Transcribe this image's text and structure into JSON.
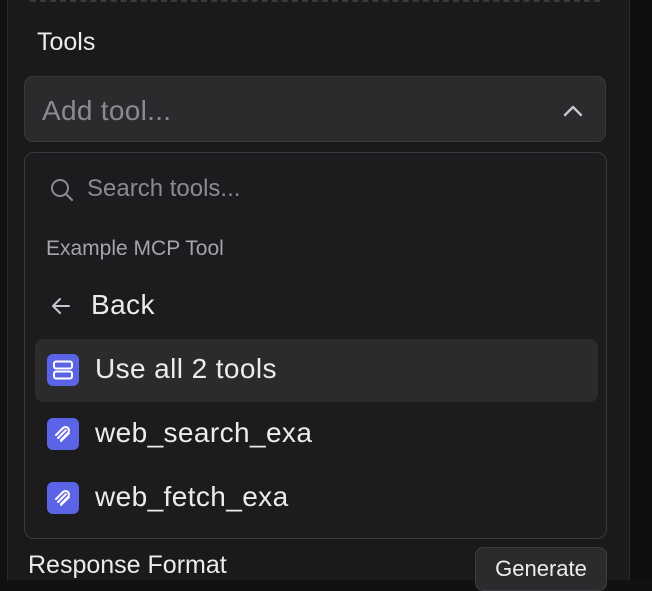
{
  "tools_section": {
    "label": "Tools",
    "select": {
      "placeholder": "Add tool...",
      "chevron_icon": "chevron-up-icon"
    }
  },
  "dropdown": {
    "search": {
      "placeholder": "Search tools...",
      "icon": "search-icon"
    },
    "group_label": "Example MCP Tool",
    "back": {
      "label": "Back",
      "icon": "arrow-left-icon"
    },
    "items": [
      {
        "label": "Use all 2 tools",
        "icon": "server-stack-icon",
        "highlighted": true
      },
      {
        "label": "web_search_exa",
        "icon": "tool-icon",
        "highlighted": false
      },
      {
        "label": "web_fetch_exa",
        "icon": "tool-icon",
        "highlighted": false
      }
    ]
  },
  "response_format": {
    "label": "Response Format",
    "generate_label": "Generate"
  },
  "colors": {
    "background": "#1a1a1b",
    "accent": "#5b63e6",
    "text": "#ececee",
    "muted": "#8a8a90"
  }
}
